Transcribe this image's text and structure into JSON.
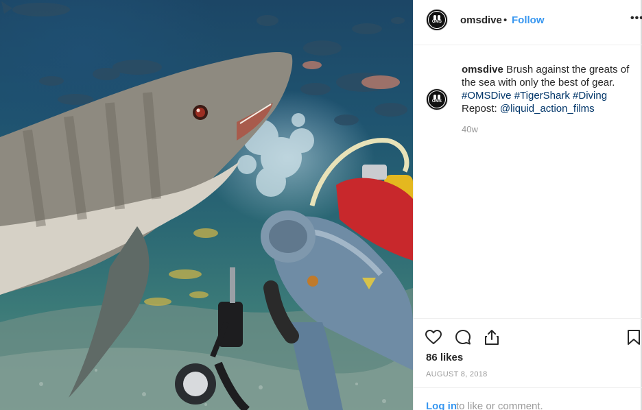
{
  "post": {
    "image_alt": "",
    "header": {
      "username": "omsdive",
      "separator": "•",
      "follow_label": "Follow",
      "more_label": "•••"
    },
    "avatar": {
      "logo_text": "OMS"
    },
    "caption": {
      "username": "omsdive",
      "text": "Brush against the greats of the sea with only the best of gear.",
      "hashtags": [
        "#OMSDive",
        "#TigerShark",
        "#Diving"
      ],
      "repost_label": "Repost:",
      "repost_handle": "@liquid_action_films"
    },
    "age": "40w",
    "actions": {
      "like_icon": "heart-icon",
      "comment_icon": "comment-icon",
      "share_icon": "share-icon",
      "save_icon": "bookmark-icon"
    },
    "likes": "86 likes",
    "date": "AUGUST 8, 2018",
    "login": {
      "link_label": "Log in",
      "rest_text": "to like or comment."
    }
  },
  "colors": {
    "accent": "#3897f0",
    "hashtag": "#003569",
    "muted": "#999999",
    "text": "#262626"
  }
}
